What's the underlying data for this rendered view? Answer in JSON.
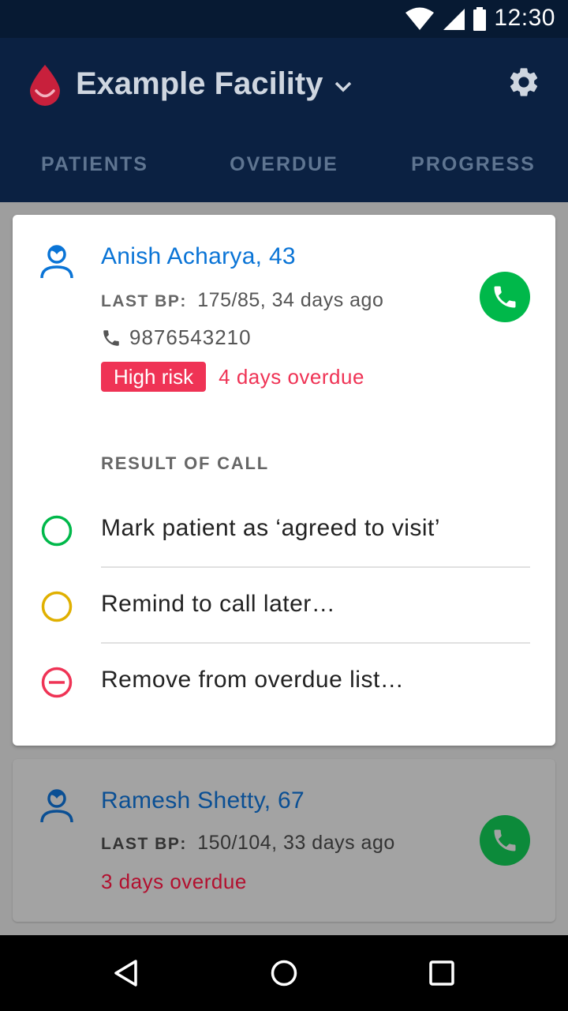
{
  "status_bar": {
    "time": "12:30"
  },
  "app_bar": {
    "facility_name": "Example Facility",
    "icons": {
      "logo": "blood-drop-logo",
      "dropdown": "chevron-down-icon",
      "settings": "gear-icon"
    }
  },
  "tabs": [
    {
      "label": "PATIENTS"
    },
    {
      "label": "OVERDUE"
    },
    {
      "label": "PROGRESS"
    }
  ],
  "patients": [
    {
      "name": "Anish Acharya, 43",
      "last_bp_label": "LAST BP:",
      "last_bp_value": "175/85, 34 days ago",
      "phone": "9876543210",
      "risk_badge": "High risk",
      "overdue": "4 days overdue",
      "expanded": true
    },
    {
      "name": "Ramesh Shetty, 67",
      "last_bp_label": "LAST BP:",
      "last_bp_value": "150/104, 33 days ago",
      "overdue": "3 days overdue",
      "expanded": false
    }
  ],
  "call_result": {
    "heading": "RESULT OF CALL",
    "options": [
      {
        "label": "Mark patient as ‘agreed to visit’",
        "color": "#00b84a"
      },
      {
        "label": "Remind to call later…",
        "color": "#e0b000"
      },
      {
        "label": "Remove from overdue list…",
        "color": "#ef3355"
      }
    ]
  },
  "colors": {
    "app_bar": "#0b2142",
    "accent_blue": "#0a74d6",
    "call_green": "#00b84a",
    "risk_red": "#ef3355"
  }
}
